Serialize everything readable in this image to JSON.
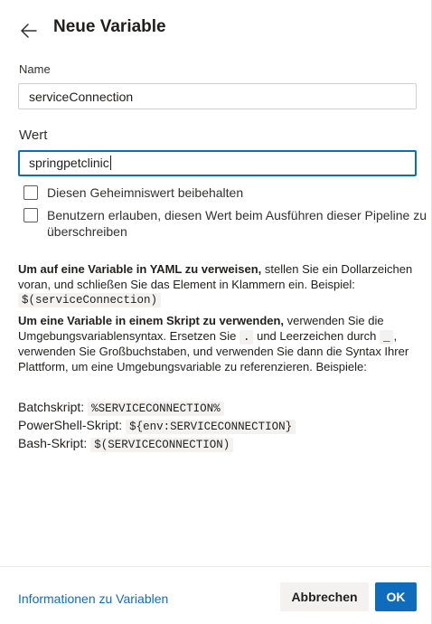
{
  "header": {
    "title": "Neue Variable"
  },
  "form": {
    "name_label": "Name",
    "name_value": "serviceConnection",
    "value_label": "Wert",
    "value_value": "springpetclinic",
    "secret_checkbox_label": "Diesen Geheimniswert beibehalten",
    "override_checkbox_label": "Benutzern erlauben, diesen Wert beim Ausführen dieser Pipeline zu überschreiben"
  },
  "help": {
    "yaml_bold": "Um auf eine Variable in YAML zu verweisen,",
    "yaml_text": " stellen Sie ein Dollarzeichen voran, und schließen Sie das Element in Klammern ein. Beispiel: ",
    "yaml_example": "$(serviceConnection)",
    "script_bold": "Um eine Variable in einem Skript zu verwenden,",
    "script_text_1": " verwenden Sie die Umgebungsvariablensyntax. Ersetzen Sie ",
    "script_dot": ".",
    "script_text_2": " und Leerzeichen durch ",
    "script_underscore": "_",
    "script_text_3": ", verwenden Sie Großbuchstaben, und verwenden Sie dann die Syntax Ihrer Plattform, um eine Umgebungsvariable zu referenzieren. Beispiele:"
  },
  "examples": [
    {
      "label": "Batchskript:",
      "code": "%SERVICECONNECTION%"
    },
    {
      "label": "PowerShell-Skript:",
      "code": "${env:SERVICECONNECTION}"
    },
    {
      "label": "Bash-Skript:",
      "code": "$(SERVICECONNECTION)"
    }
  ],
  "footer": {
    "info_link": "Informationen zu Variablen",
    "cancel_label": "Abbrechen",
    "ok_label": "OK"
  },
  "icons": {
    "back": "arrow-left-icon"
  },
  "colors": {
    "accent": "#0f6cbd",
    "text": "#201f1e",
    "border": "#d2d0ce",
    "secondary_button": "#f3f2f1"
  }
}
